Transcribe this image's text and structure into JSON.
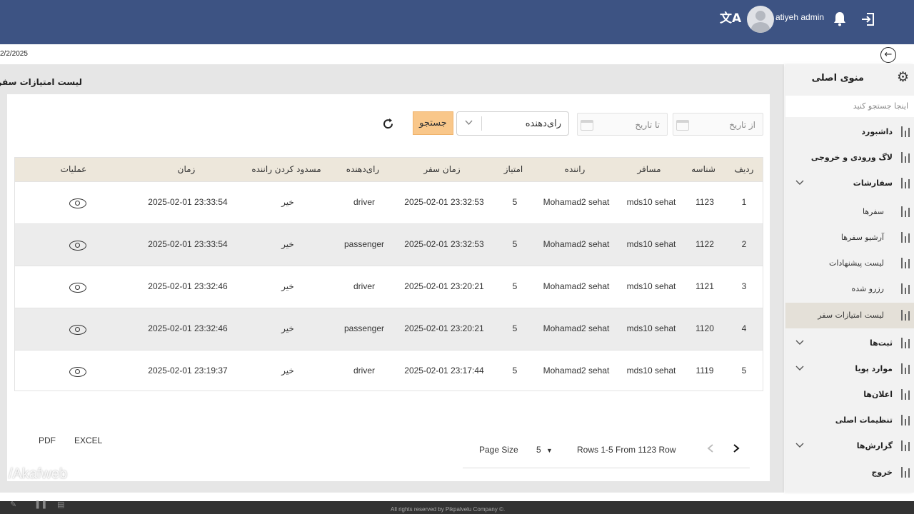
{
  "header": {
    "user_name": "atiyeh admin",
    "icons": [
      "translate-icon",
      "user-avatar",
      "bell-icon",
      "logout-icon"
    ],
    "accent_color": "#3d5383"
  },
  "date_display": "2/2/2025",
  "page": {
    "title": "لیست امتیازات سفر"
  },
  "filters": {
    "from_date_placeholder": "از تاریخ",
    "to_date_placeholder": "تا تاریخ",
    "rater_select_value": "رای‌دهنده",
    "search_label": "جستجو",
    "search_color": "#f9c78a"
  },
  "table": {
    "headers": [
      "ردیف",
      "شناسه",
      "مسافر",
      "راننده",
      "امتیاز",
      "زمان سفر",
      "رای‌دهنده",
      "مسدود کردن راننده",
      "زمان",
      "عملیات"
    ],
    "rows": [
      {
        "row": "1",
        "id": "1123",
        "passenger": "mds10 sehat",
        "driver": "Mohamad2 sehat",
        "score": "5",
        "trip_time": "2025-02-01 23:32:53",
        "rater": "driver",
        "block": "خیر",
        "time": "2025-02-01 23:33:54"
      },
      {
        "row": "2",
        "id": "1122",
        "passenger": "mds10 sehat",
        "driver": "Mohamad2 sehat",
        "score": "5",
        "trip_time": "2025-02-01 23:32:53",
        "rater": "passenger",
        "block": "خیر",
        "time": "2025-02-01 23:33:54"
      },
      {
        "row": "3",
        "id": "1121",
        "passenger": "mds10 sehat",
        "driver": "Mohamad2 sehat",
        "score": "5",
        "trip_time": "2025-02-01 23:20:21",
        "rater": "driver",
        "block": "خیر",
        "time": "2025-02-01 23:32:46"
      },
      {
        "row": "4",
        "id": "1120",
        "passenger": "mds10 sehat",
        "driver": "Mohamad2 sehat",
        "score": "5",
        "trip_time": "2025-02-01 23:20:21",
        "rater": "passenger",
        "block": "خیر",
        "time": "2025-02-01 23:32:46"
      },
      {
        "row": "5",
        "id": "1119",
        "passenger": "mds10 sehat",
        "driver": "Mohamad2 sehat",
        "score": "5",
        "trip_time": "2025-02-01 23:17:44",
        "rater": "driver",
        "block": "خیر",
        "time": "2025-02-01 23:19:37"
      }
    ]
  },
  "export": {
    "pdf_label": "PDF",
    "excel_label": "EXCEL"
  },
  "pagination": {
    "page_size_label": "Page Size",
    "page_size_value": "5",
    "rows_info": "Rows 1-5 From 1123 Row"
  },
  "watermark": "/Akafweb",
  "sidebar": {
    "title": "منوی اصلی",
    "search_placeholder": "اینجا جستجو کنید",
    "items": [
      {
        "label": "داشبورد",
        "bold": true
      },
      {
        "label": "لاگ ورودی و خروجی",
        "bold": true
      },
      {
        "label": "سفارشات",
        "bold": true
      },
      {
        "label": "سفرها",
        "bold": false
      },
      {
        "label": "آرشیو سفرها",
        "bold": false
      },
      {
        "label": "لیست پیشنهادات",
        "bold": false
      },
      {
        "label": "رزرو شده",
        "bold": false
      },
      {
        "label": "لیست امتیازات سفر",
        "bold": false
      },
      {
        "label": "ثبت‌ها",
        "bold": true
      },
      {
        "label": "موارد پویا",
        "bold": true
      },
      {
        "label": "اعلان‌ها",
        "bold": true
      },
      {
        "label": "تنظیمات اصلی",
        "bold": true
      },
      {
        "label": "گزارش‌ها",
        "bold": true
      },
      {
        "label": "خروج",
        "bold": true
      }
    ],
    "active_color": "#e4e0d8"
  },
  "footer": {
    "copyright": "All rights reserved by Pikpalvelu Company ©."
  }
}
